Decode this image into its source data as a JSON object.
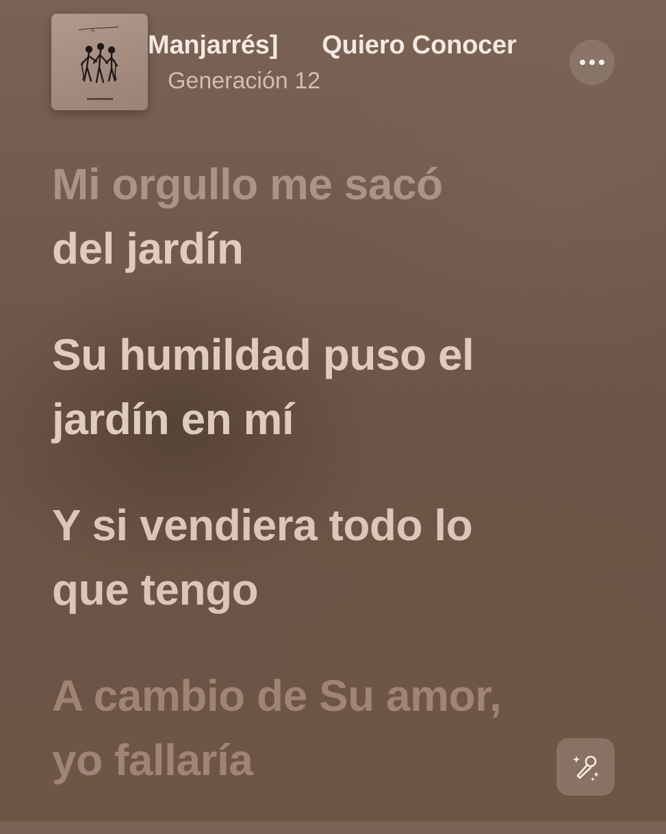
{
  "now_playing": {
    "title_marquee": [
      "Manjarrés]",
      "Quiero Conocer"
    ],
    "artist": "Generación 12"
  },
  "lyrics": {
    "line1": [
      "Mi orgullo me sacó",
      "del jardín"
    ],
    "line2": [
      "Su humildad puso el",
      "jardín en mí"
    ],
    "line3": [
      "Y si vendiera todo lo",
      "que tengo"
    ],
    "line4": [
      "A cambio de Su amor,",
      "yo fallaría"
    ]
  },
  "icons": {
    "more": "more-icon",
    "sing": "microphone-sparkles-icon"
  },
  "colors": {
    "background": "#6e5647",
    "active_lyric": "#e0cbc0",
    "dim_lyric": "#b89c8e"
  }
}
